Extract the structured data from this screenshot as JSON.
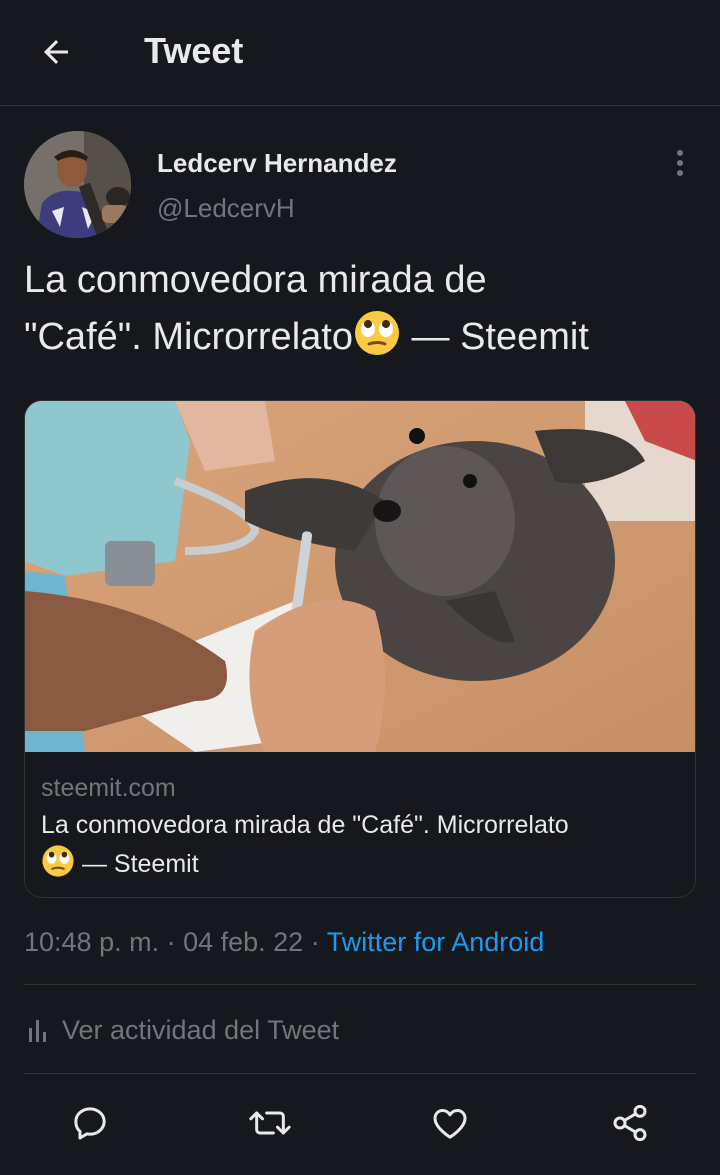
{
  "header": {
    "title": "Tweet",
    "back_icon": "arrow-left-icon"
  },
  "author": {
    "name": "Ledcerv Hernandez",
    "handle": "@LedcervH",
    "more_icon": "more-vertical-icon"
  },
  "tweet": {
    "line1": "La conmovedora mirada de",
    "line2_before_emoji": "\"Café\". Microrrelato",
    "emoji": "face-with-rolling-eyes",
    "line2_after_emoji": " — Steemit"
  },
  "card": {
    "domain": "steemit.com",
    "title_line1": "La conmovedora mirada de \"Café\". Microrrelato",
    "title_line2_after_emoji": " — Steemit"
  },
  "meta": {
    "time": "10:48 p. m.",
    "separator": " · ",
    "date": "04 feb. 22",
    "source": "Twitter for Android"
  },
  "activity": {
    "label": "Ver actividad del Tweet",
    "icon": "analytics-icon"
  },
  "actions": {
    "reply_icon": "reply-icon",
    "retweet_icon": "retweet-icon",
    "like_icon": "heart-icon",
    "share_icon": "share-icon"
  },
  "colors": {
    "background": "#15181c",
    "text": "#e7e9ea",
    "secondary": "#71767b",
    "accent": "#1d9bf0",
    "border": "#2f3336"
  }
}
